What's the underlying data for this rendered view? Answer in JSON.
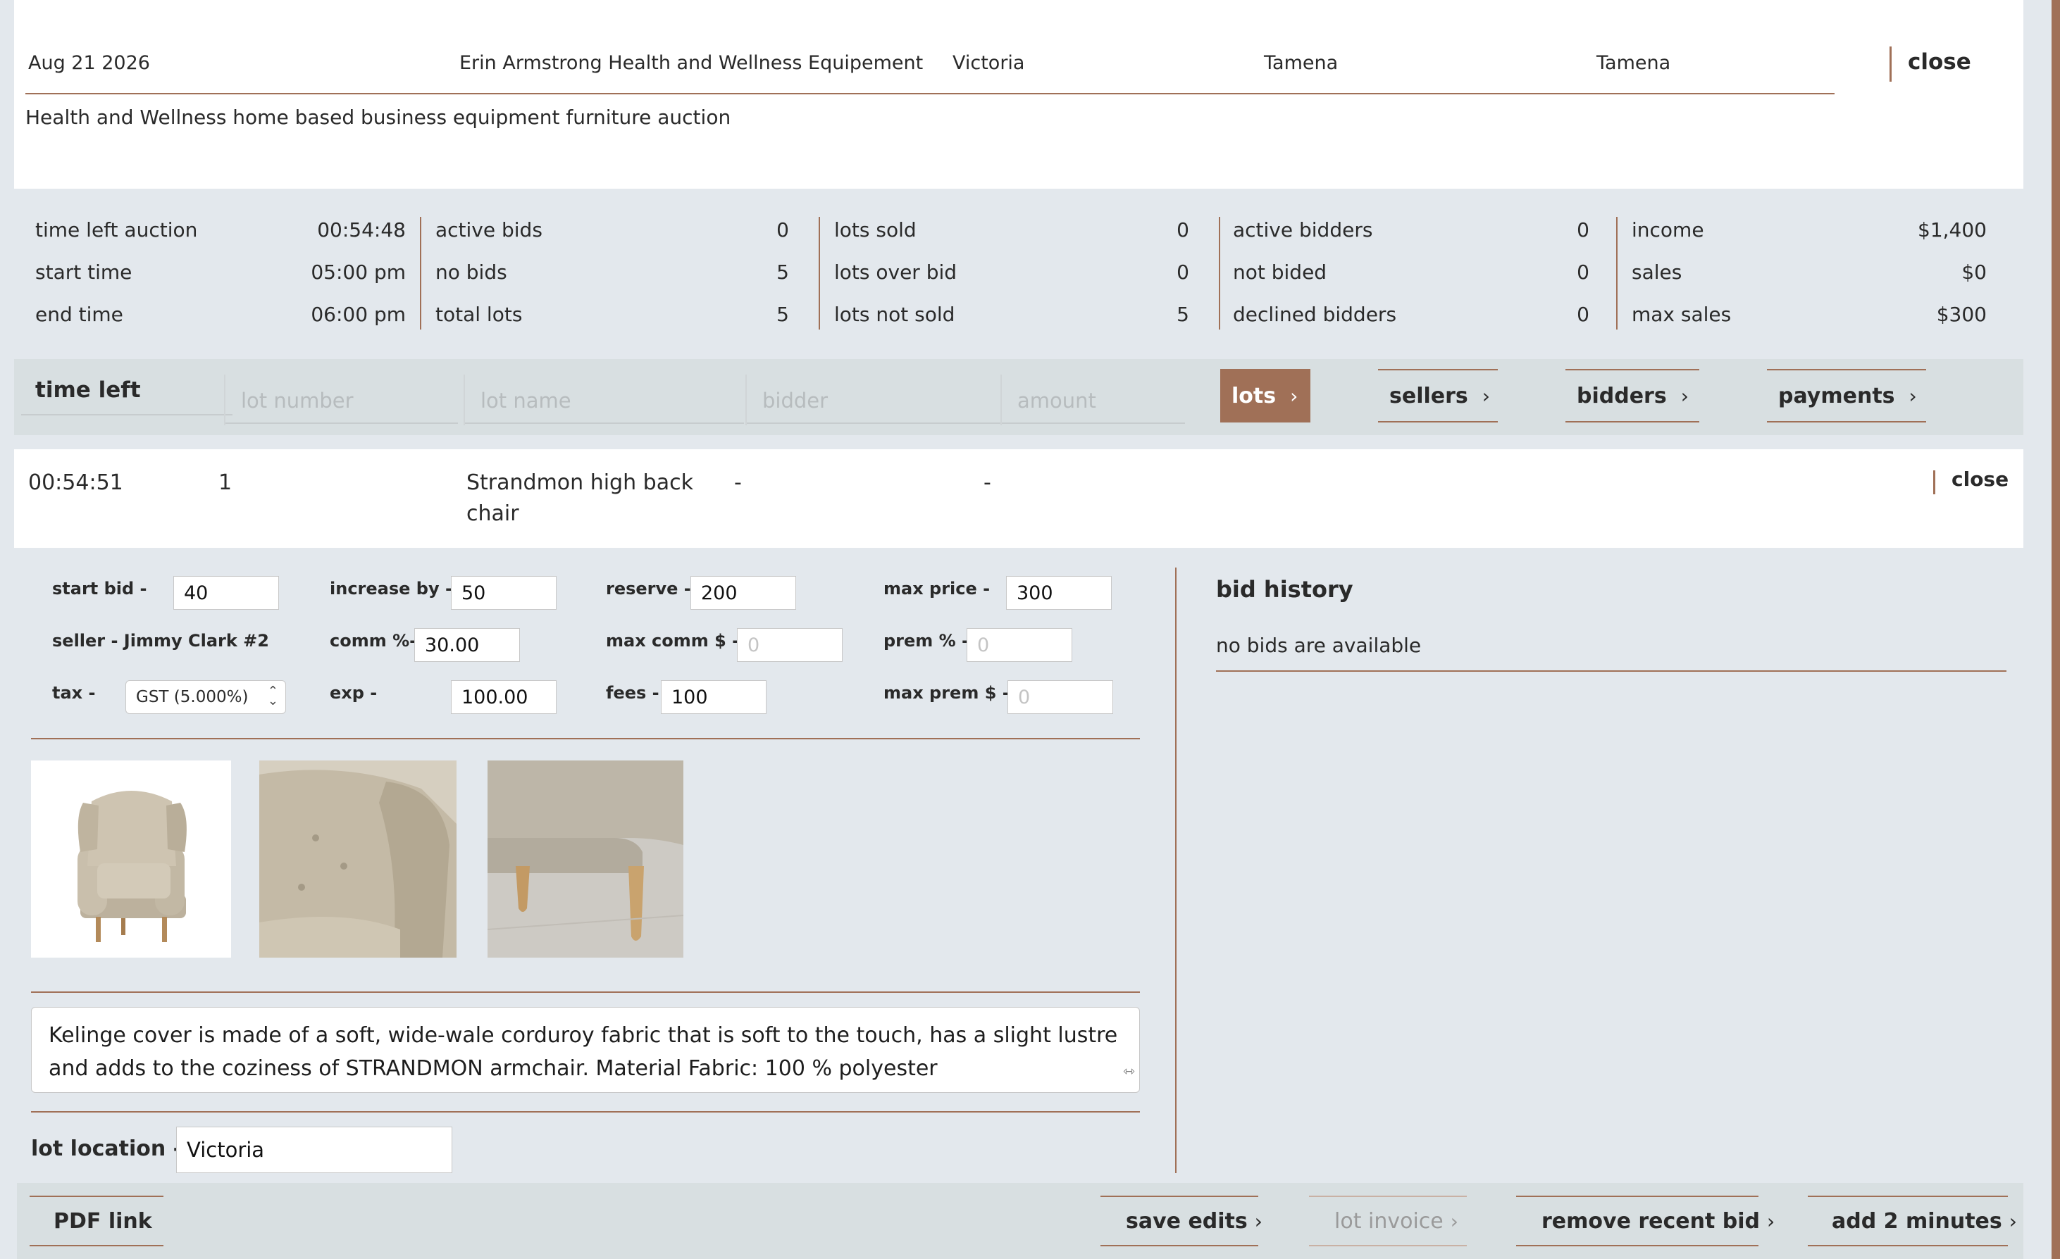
{
  "header": {
    "date": "Aug 21 2026",
    "name": "Erin Armstrong Health and Wellness Equipement",
    "city": "Victoria",
    "field1": "Tamena",
    "field2": "Tamena",
    "close_label": "close",
    "subtitle": "Health and Wellness home based business equipment furniture auction"
  },
  "stats": {
    "time_left_auction": {
      "label": "time left auction",
      "value": "00:54:48"
    },
    "start_time": {
      "label": "start time",
      "value": "05:00 pm"
    },
    "end_time": {
      "label": "end time",
      "value": "06:00 pm"
    },
    "active_bids": {
      "label": "active bids",
      "value": "0"
    },
    "no_bids": {
      "label": "no bids",
      "value": "5"
    },
    "total_lots": {
      "label": "total lots",
      "value": "5"
    },
    "lots_sold": {
      "label": "lots sold",
      "value": "0"
    },
    "lots_over_bid": {
      "label": "lots over bid",
      "value": "0"
    },
    "lots_not_sold": {
      "label": "lots not sold",
      "value": "5"
    },
    "active_bidders": {
      "label": "active bidders",
      "value": "0"
    },
    "not_bided": {
      "label": "not bided",
      "value": "0"
    },
    "declined_bidders": {
      "label": "declined bidders",
      "value": "0"
    },
    "income": {
      "label": "income",
      "value": "$1,400"
    },
    "sales": {
      "label": "sales",
      "value": "$0"
    },
    "max_sales": {
      "label": "max sales",
      "value": "$300"
    }
  },
  "filter": {
    "time_left_label": "time left",
    "lot_number_placeholder": "lot number",
    "lot_name_placeholder": "lot name",
    "bidder_placeholder": "bidder",
    "amount_placeholder": "amount"
  },
  "nav": {
    "lots": "lots",
    "sellers": "sellers",
    "bidders": "bidders",
    "payments": "payments"
  },
  "lot": {
    "time_left": "00:54:51",
    "number": "1",
    "name": "Strandmon high back chair",
    "bidder": "-",
    "amount": "-",
    "close_label": "close"
  },
  "form": {
    "start_bid_label": "start bid -",
    "start_bid": "40",
    "increase_label": "increase by -",
    "increase": "50",
    "reserve_label": "reserve -",
    "reserve": "200",
    "max_price_label": "max price -",
    "max_price": "300",
    "seller_label": "seller - Jimmy Clark #2",
    "comm_label": "comm %-",
    "comm": "30.00",
    "max_comm_label": "max comm $ -",
    "max_comm_placeholder": "0",
    "prem_label": "prem % -",
    "prem_placeholder": "0",
    "tax_label": "tax -",
    "tax_value": "GST (5.000%)",
    "exp_label": "exp -",
    "exp": "100.00",
    "fees_label": "fees -",
    "fees": "100",
    "max_prem_label": "max prem $ -",
    "max_prem_placeholder": "0",
    "description": "Kelinge cover is made of a soft, wide-wale corduroy fabric that is soft to the touch, has a slight lustre and adds to the coziness of STRANDMON armchair. Material Fabric: 100 % polyester",
    "location_label": "lot location -",
    "location": "Victoria"
  },
  "bid_history": {
    "title": "bid history",
    "empty": "no bids are available"
  },
  "actions": {
    "pdf": "PDF link",
    "save": "save edits",
    "invoice": "lot invoice",
    "remove": "remove recent bid",
    "add_minutes": "add 2 minutes"
  },
  "colors": {
    "accent": "#a07057",
    "background": "#e3e8ed",
    "bar": "#d8dfe1"
  }
}
